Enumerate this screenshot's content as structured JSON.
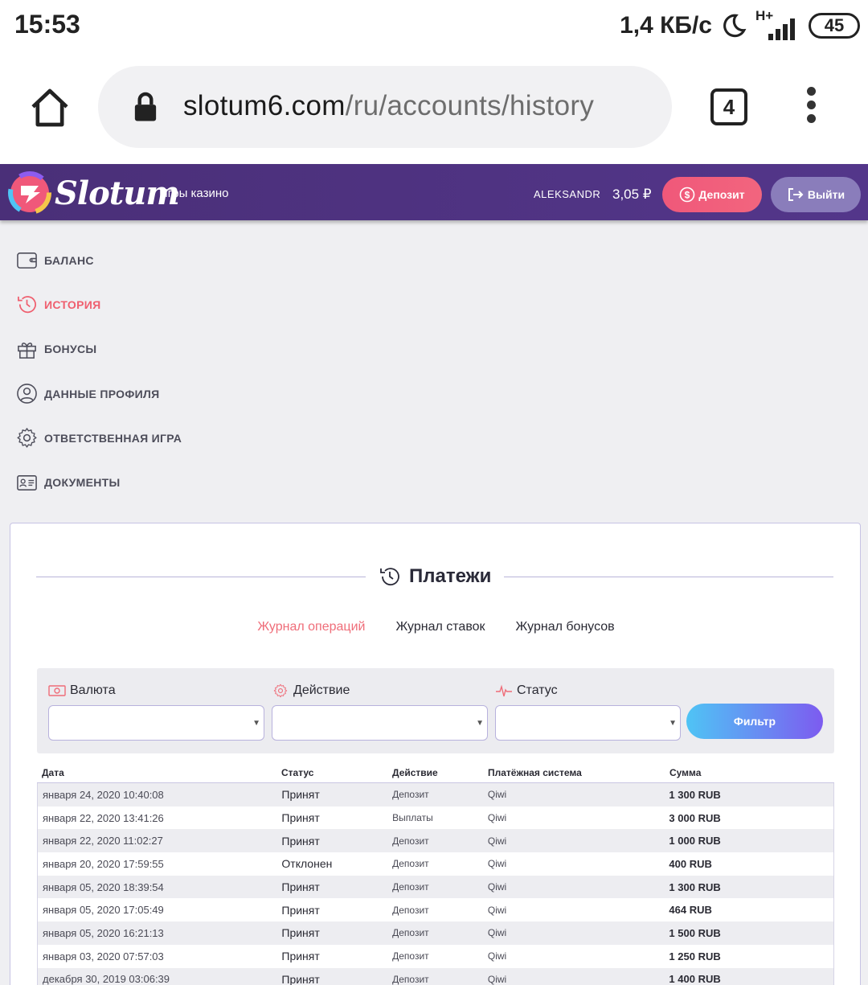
{
  "status_bar": {
    "time": "15:53",
    "net_speed": "1,4 КБ/с",
    "network_type": "H+",
    "battery": "45"
  },
  "browser": {
    "url_host": "slotum6.com",
    "url_path": "/ru/accounts/history",
    "tab_count": "4"
  },
  "header": {
    "logo_text": "Slotum",
    "nav_games": "Игры казино",
    "username": "ALEKSANDR",
    "balance": "3,05 ₽",
    "deposit_label": "Депозит",
    "logout_label": "Выйти",
    "colors": {
      "header_bg": "#4a2f78",
      "deposit_bg": "#f0587a",
      "logout_bg": "#8a7dbb"
    }
  },
  "sidebar": {
    "items": [
      {
        "label": "БАЛАНС",
        "icon": "wallet-icon",
        "active": false
      },
      {
        "label": "ИСТОРИЯ",
        "icon": "history-icon",
        "active": true
      },
      {
        "label": "БОНУСЫ",
        "icon": "gift-icon",
        "active": false
      },
      {
        "label": "ДАННЫЕ ПРОФИЛЯ",
        "icon": "user-icon",
        "active": false
      },
      {
        "label": "ОТВЕТСТВЕННАЯ ИГРА",
        "icon": "gear-icon",
        "active": false
      },
      {
        "label": "ДОКУМЕНТЫ",
        "icon": "id-card-icon",
        "active": false
      }
    ]
  },
  "main": {
    "title": "Платежи",
    "tabs": [
      {
        "label": "Журнал операций",
        "active": true
      },
      {
        "label": "Журнал ставок",
        "active": false
      },
      {
        "label": "Журнал бонусов",
        "active": false
      }
    ],
    "filters": {
      "currency_label": "Валюта",
      "action_label": "Действие",
      "status_label": "Статус",
      "currency_value": "",
      "action_value": "",
      "status_value": "",
      "filter_button": "Фильтр"
    },
    "table": {
      "columns": [
        "Дата",
        "Статус",
        "Действие",
        "Платёжная система",
        "Сумма"
      ],
      "rows": [
        [
          "января 24, 2020 10:40:08",
          "Принят",
          "Депозит",
          "Qiwi",
          "1 300 RUB"
        ],
        [
          "января 22, 2020 13:41:26",
          "Принят",
          "Выплаты",
          "Qiwi",
          "3 000 RUB"
        ],
        [
          "января 22, 2020 11:02:27",
          "Принят",
          "Депозит",
          "Qiwi",
          "1 000 RUB"
        ],
        [
          "января 20, 2020 17:59:55",
          "Отклонен",
          "Депозит",
          "Qiwi",
          "400 RUB"
        ],
        [
          "января 05, 2020 18:39:54",
          "Принят",
          "Депозит",
          "Qiwi",
          "1 300 RUB"
        ],
        [
          "января 05, 2020 17:05:49",
          "Принят",
          "Депозит",
          "Qiwi",
          "464 RUB"
        ],
        [
          "января 05, 2020 16:21:13",
          "Принят",
          "Депозит",
          "Qiwi",
          "1 500 RUB"
        ],
        [
          "января 03, 2020 07:57:03",
          "Принят",
          "Депозит",
          "Qiwi",
          "1 250 RUB"
        ],
        [
          "декабря 30, 2019 03:06:39",
          "Принят",
          "Депозит",
          "Qiwi",
          "1 400 RUB"
        ]
      ]
    }
  }
}
